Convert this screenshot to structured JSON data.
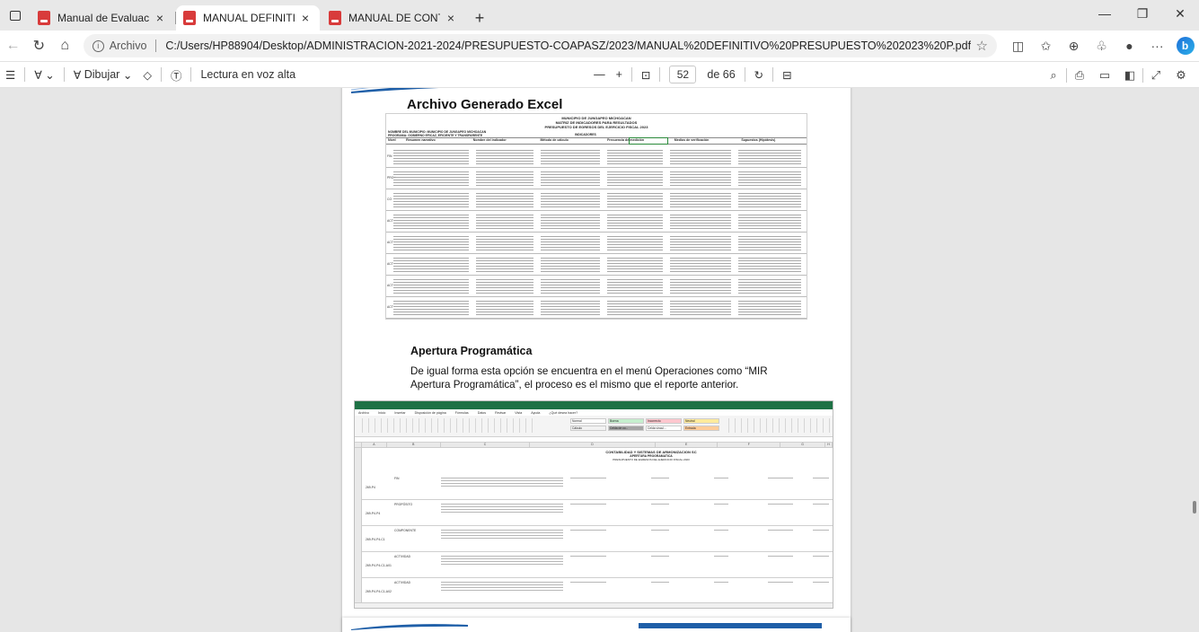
{
  "tabs": [
    {
      "title": "Manual de Evaluación de Registr",
      "active": false
    },
    {
      "title": "MANUAL DEFINITIVO PRESUPUE",
      "active": true
    },
    {
      "title": "MANUAL DE CONTABILIDAD DE",
      "active": false
    }
  ],
  "address": {
    "scheme": "Archivo",
    "url": "C:/Users/HP88904/Desktop/ADMINISTRACION-2021-2024/PRESUPUESTO-COAPASZ/2023/MANUAL%20DEFINITIVO%20PRESUPUESTO%202023%20P.pdf"
  },
  "pdf_toolbar": {
    "draw_label": "Dibujar",
    "read_aloud_label": "Lectura en voz alta",
    "page_current": "52",
    "page_total": "de 66"
  },
  "document": {
    "section1_title": "Archivo Generado Excel",
    "sheet1": {
      "title_lines": [
        "MUNICIPIO DE JUNGAPEO MICHOACAN",
        "MATRIZ DE INDICADORES PARA RESULTADOS",
        "PRESUPUESTO DE EGRESOS DEL EJERCICIO FISCAL 2023"
      ],
      "left_lines": [
        "NOMBRE DEL MUNICIPIO: MUNICIPIO DE JUNGAPEO MICHOACAN",
        "PROGRAMA: GOBIERNO EFICAZ, EFICIENTE Y TRANSPARENTE"
      ],
      "indicator_label": "INDICADORES",
      "columns": [
        "Nivel",
        "Resumen narrativo",
        "Nombre del indicador",
        "Método de cálculo",
        "Frecuencia de medición",
        "Medios de verificación",
        "Supuestos (Hipótesis)"
      ],
      "row_ids": [
        "FIN",
        "PROP",
        "CO",
        "ACT",
        "ACT",
        "ACT",
        "ACT",
        "ACT"
      ]
    },
    "section2_title": "Apertura Programática",
    "section2_text": "De igual forma esta opción se encuentra en el menú Operaciones como “MIR Apertura Programática”, el proceso es el mismo que el reporte anterior.",
    "sheet2": {
      "menu_items": [
        "Archivo",
        "Inicio",
        "Insertar",
        "Disposición de página",
        "Fórmulas",
        "Datos",
        "Revisar",
        "Vista",
        "Ayuda",
        "¿Qué desea hacer?"
      ],
      "styles": [
        {
          "label": "Normal",
          "color": "#ffffff"
        },
        {
          "label": "Buena",
          "color": "#c6efce"
        },
        {
          "label": "Incorrecto",
          "color": "#ffc7ce"
        },
        {
          "label": "Neutral",
          "color": "#ffeb9c"
        },
        {
          "label": "Cálculo",
          "color": "#f2f2f2"
        },
        {
          "label": "Celda de co...",
          "color": "#a5a5a5"
        },
        {
          "label": "Celda vincul...",
          "color": "#ffffff"
        },
        {
          "label": "Entrada",
          "color": "#ffcc99"
        }
      ],
      "title_lines": [
        "CONTABILIDAD Y SISTEMAS DE ARMONIZACION SC",
        "APERTURA PROGRAMATICA",
        "PRESUPUESTO DE EGRESOS DEL EJERCICIO FISCAL 2023"
      ],
      "col_letters": [
        "A",
        "B",
        "C",
        "D",
        "E",
        "F",
        "G",
        "H"
      ],
      "row_codes": [
        "269-P4",
        "269-P4-P4",
        "269-P4-P4-C1",
        "269-P4-P4-C1-A01",
        "269-P4-P4-C1-A02"
      ],
      "row_types": [
        "FIN",
        "PROPÓSITO",
        "COMPONENTE",
        "ACTIVIDAD",
        "ACTIVIDAD"
      ]
    }
  },
  "colors": {
    "excel_green": "#1e7145",
    "accent_blue": "#1f5fa8",
    "pdf_red": "#d83b3b"
  }
}
